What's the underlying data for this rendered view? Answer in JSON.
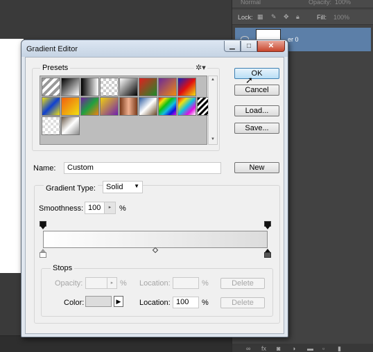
{
  "background": {
    "blend_mode": "Normal",
    "opacity_label": "Opacity:",
    "opacity_value": "100%",
    "lock_label": "Lock:",
    "fill_label": "Fill:",
    "fill_value": "100%",
    "layer_name": "er 0"
  },
  "dialog": {
    "title": "Gradient Editor",
    "presets": {
      "label": "Presets",
      "gear_icon": "gear-icon",
      "swatches": [
        {
          "kind": "fg-to-bg"
        },
        {
          "kind": "fg-to-transparent"
        },
        {
          "kind": "black-white"
        },
        {
          "kind": "checker"
        },
        {
          "kind": "white-black"
        },
        {
          "kind": "red-green"
        },
        {
          "kind": "violet-orange"
        },
        {
          "kind": "blue-red-yellow"
        },
        {
          "kind": "blue-yellow-blue"
        },
        {
          "kind": "orange-yellow"
        },
        {
          "kind": "violet-green-orange"
        },
        {
          "kind": "yellow-violet"
        },
        {
          "kind": "copper"
        },
        {
          "kind": "chrome"
        },
        {
          "kind": "spectrum"
        },
        {
          "kind": "transparent-rainbow"
        },
        {
          "kind": "transparent-stripes"
        },
        {
          "kind": "transparent-checker"
        },
        {
          "kind": "gray-diagonal"
        }
      ]
    },
    "buttons": {
      "ok": "OK",
      "cancel": "Cancel",
      "load": "Load...",
      "save": "Save...",
      "new": "New"
    },
    "name": {
      "label": "Name:",
      "value": "Custom"
    },
    "gradient_type": {
      "label": "Gradient Type:",
      "value": "Solid"
    },
    "smoothness": {
      "label": "Smoothness:",
      "value": "100",
      "unit": "%"
    },
    "gradient": {
      "start_color": "#ffffff",
      "end_color": "#dcdcdc"
    },
    "stops": {
      "label": "Stops",
      "opacity_label": "Opacity:",
      "opacity_value": "",
      "opacity_unit": "%",
      "opacity_location_label": "Location:",
      "opacity_location_value": "",
      "opacity_location_unit": "%",
      "delete_label": "Delete",
      "color_label": "Color:",
      "color_value": "#dcdcdc",
      "color_location_label": "Location:",
      "color_location_value": "100",
      "color_location_unit": "%",
      "color_delete_label": "Delete"
    }
  }
}
